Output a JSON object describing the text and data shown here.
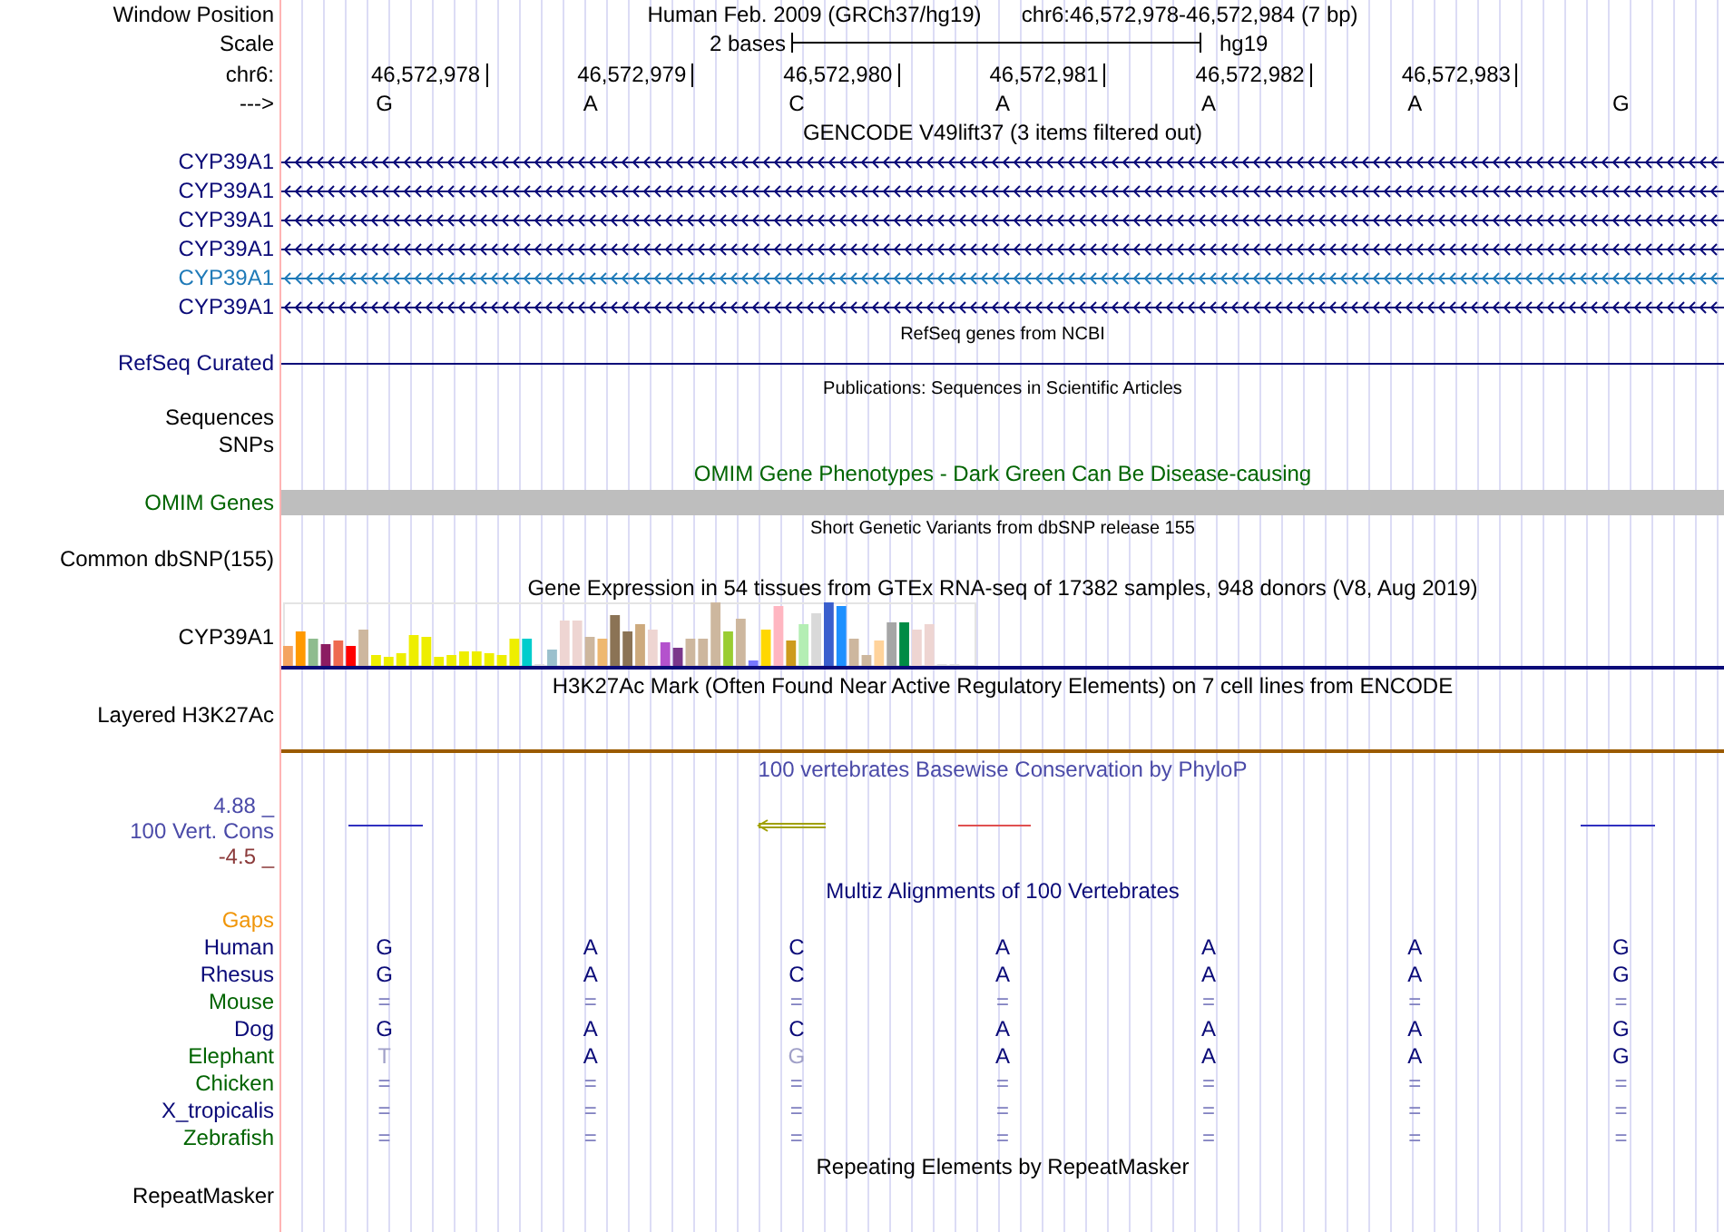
{
  "header": {
    "window_position_label": "Window Position",
    "assembly": "Human Feb. 2009 (GRCh37/hg19)",
    "range": "chr6:46,572,978-46,572,984 (7 bp)",
    "scale_label": "Scale",
    "scale_text": "2 bases",
    "scale_assembly": "hg19",
    "chrom_label": "chr6:",
    "positions": [
      "46,572,978",
      "46,572,979",
      "46,572,980",
      "46,572,981",
      "46,572,982",
      "46,572,983"
    ],
    "strand_label": "--->",
    "bases": [
      "G",
      "A",
      "C",
      "A",
      "A",
      "A",
      "G"
    ]
  },
  "tracks": [
    {
      "kind": "title",
      "text": "GENCODE V49lift37 (3 items filtered out)",
      "color": "#000000"
    },
    {
      "kind": "gene",
      "label": "CYP39A1",
      "color": "#0a0a78"
    },
    {
      "kind": "gene",
      "label": "CYP39A1",
      "color": "#0a0a78"
    },
    {
      "kind": "gene",
      "label": "CYP39A1",
      "color": "#0a0a78"
    },
    {
      "kind": "gene",
      "label": "CYP39A1",
      "color": "#0a0a78"
    },
    {
      "kind": "gene",
      "label": "CYP39A1",
      "color": "#1f7ab8"
    },
    {
      "kind": "gene",
      "label": "CYP39A1",
      "color": "#0a0a78"
    },
    {
      "kind": "small_title",
      "text": "RefSeq genes from NCBI"
    },
    {
      "kind": "line",
      "label": "RefSeq Curated",
      "color": "#0a0a78"
    },
    {
      "kind": "small_title",
      "text": "Publications: Sequences in Scientific Articles"
    },
    {
      "kind": "label",
      "label": "Sequences",
      "color": "#000000"
    },
    {
      "kind": "label",
      "label": "SNPs",
      "color": "#000000"
    },
    {
      "kind": "title",
      "text": "OMIM Gene Phenotypes - Dark Green Can Be Disease-causing",
      "color": "#006400"
    },
    {
      "kind": "bar",
      "label": "OMIM Genes",
      "color": "#006400"
    },
    {
      "kind": "small_title",
      "text": "Short Genetic Variants from dbSNP release 155"
    },
    {
      "kind": "label",
      "label": "Common dbSNP(155)",
      "color": "#000000"
    },
    {
      "kind": "title",
      "text": "Gene Expression in 54 tissues from GTEx RNA-seq of 17382 samples, 948 donors (V8, Aug 2019)",
      "color": "#000000"
    },
    {
      "kind": "expression",
      "label": "CYP39A1",
      "color": "#000000"
    },
    {
      "kind": "title",
      "text": "H3K27Ac Mark (Often Found Near Active Regulatory Elements) on 7 cell lines from ENCODE",
      "color": "#000000"
    },
    {
      "kind": "signal",
      "label": "Layered H3K27Ac",
      "color": "#000000"
    },
    {
      "kind": "conservation",
      "max": "4.88 _",
      "label": "100 Vert. Cons",
      "min": "-4.5 _",
      "title": "100 vertebrates Basewise Conservation by PhyloP",
      "color": "#4a4aa8"
    },
    {
      "kind": "title",
      "text": "Multiz Alignments of 100 Vertebrates",
      "color": "#0a0a78"
    },
    {
      "kind": "label",
      "label": "Gaps",
      "color": "#f0960a"
    },
    {
      "kind": "alignment",
      "label": "Human",
      "color": "#0a0a78",
      "bases": [
        {
          "text": "G",
          "kind": "base"
        },
        {
          "text": "A",
          "kind": "base"
        },
        {
          "text": "C",
          "kind": "base"
        },
        {
          "text": "A",
          "kind": "base"
        },
        {
          "text": "A",
          "kind": "base"
        },
        {
          "text": "A",
          "kind": "base"
        },
        {
          "text": "G",
          "kind": "base"
        }
      ]
    },
    {
      "kind": "alignment",
      "label": "Rhesus",
      "color": "#0a0a78",
      "bases": [
        {
          "text": "G",
          "kind": "base"
        },
        {
          "text": "A",
          "kind": "base"
        },
        {
          "text": "C",
          "kind": "base"
        },
        {
          "text": "A",
          "kind": "base"
        },
        {
          "text": "A",
          "kind": "base"
        },
        {
          "text": "A",
          "kind": "base"
        },
        {
          "text": "G",
          "kind": "base"
        }
      ]
    },
    {
      "kind": "alignment",
      "label": "Mouse",
      "color": "#006400",
      "bases": [
        {
          "text": "=",
          "kind": "equal"
        },
        {
          "text": "=",
          "kind": "equal"
        },
        {
          "text": "=",
          "kind": "equal"
        },
        {
          "text": "=",
          "kind": "equal"
        },
        {
          "text": "=",
          "kind": "equal"
        },
        {
          "text": "=",
          "kind": "equal"
        },
        {
          "text": "=",
          "kind": "equal"
        }
      ]
    },
    {
      "kind": "alignment",
      "label": "Dog",
      "color": "#0a0a78",
      "bases": [
        {
          "text": "G",
          "kind": "base"
        },
        {
          "text": "A",
          "kind": "base"
        },
        {
          "text": "C",
          "kind": "base"
        },
        {
          "text": "A",
          "kind": "base"
        },
        {
          "text": "A",
          "kind": "base"
        },
        {
          "text": "A",
          "kind": "base"
        },
        {
          "text": "G",
          "kind": "base"
        }
      ]
    },
    {
      "kind": "alignment",
      "label": "Elephant",
      "color": "#006400",
      "bases": [
        {
          "text": "T",
          "kind": "mismatch"
        },
        {
          "text": "A",
          "kind": "base"
        },
        {
          "text": "G",
          "kind": "mismatch"
        },
        {
          "text": "A",
          "kind": "base"
        },
        {
          "text": "A",
          "kind": "base"
        },
        {
          "text": "A",
          "kind": "base"
        },
        {
          "text": "G",
          "kind": "base"
        }
      ]
    },
    {
      "kind": "alignment",
      "label": "Chicken",
      "color": "#006400",
      "bases": [
        {
          "text": "=",
          "kind": "equal"
        },
        {
          "text": "=",
          "kind": "equal"
        },
        {
          "text": "=",
          "kind": "equal"
        },
        {
          "text": "=",
          "kind": "equal"
        },
        {
          "text": "=",
          "kind": "equal"
        },
        {
          "text": "=",
          "kind": "equal"
        },
        {
          "text": "=",
          "kind": "equal"
        }
      ]
    },
    {
      "kind": "alignment",
      "label": "X_tropicalis",
      "color": "#0a0a78",
      "bases": [
        {
          "text": "=",
          "kind": "equal"
        },
        {
          "text": "=",
          "kind": "equal"
        },
        {
          "text": "=",
          "kind": "equal"
        },
        {
          "text": "=",
          "kind": "equal"
        },
        {
          "text": "=",
          "kind": "equal"
        },
        {
          "text": "=",
          "kind": "equal"
        },
        {
          "text": "=",
          "kind": "equal"
        }
      ]
    },
    {
      "kind": "alignment",
      "label": "Zebrafish",
      "color": "#006400",
      "bases": [
        {
          "text": "=",
          "kind": "equal"
        },
        {
          "text": "=",
          "kind": "equal"
        },
        {
          "text": "=",
          "kind": "equal"
        },
        {
          "text": "=",
          "kind": "equal"
        },
        {
          "text": "=",
          "kind": "equal"
        },
        {
          "text": "=",
          "kind": "equal"
        },
        {
          "text": "=",
          "kind": "equal"
        }
      ]
    },
    {
      "kind": "title",
      "text": "Repeating Elements by RepeatMasker",
      "color": "#000000"
    },
    {
      "kind": "tall_label",
      "label": "RepeatMasker",
      "color": "#000000"
    }
  ]
}
